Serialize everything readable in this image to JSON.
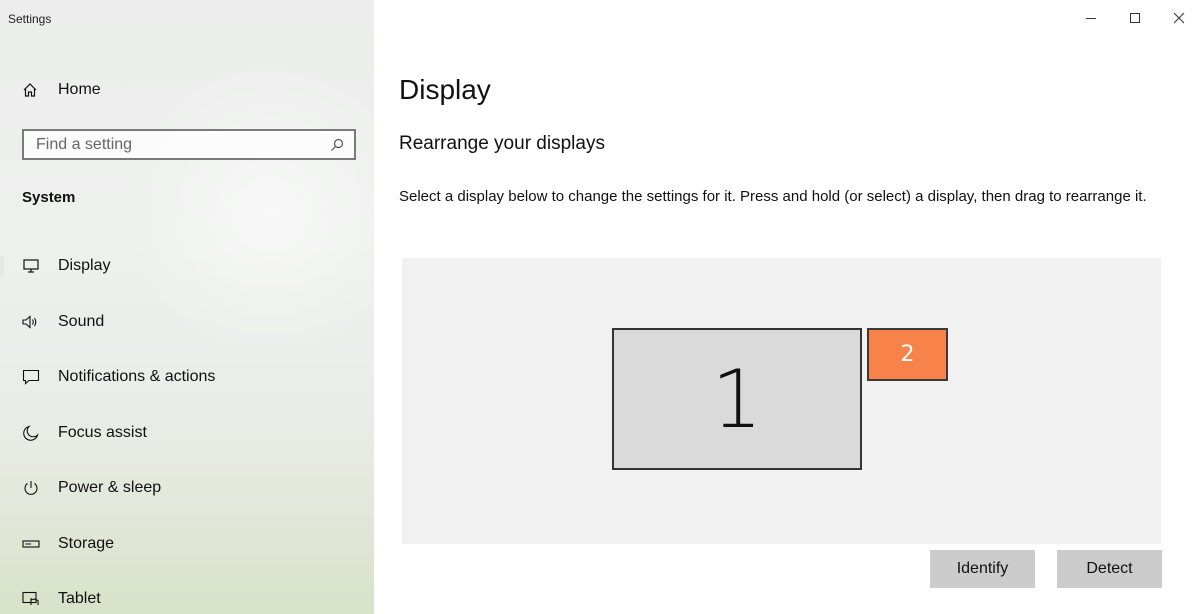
{
  "window": {
    "app_title": "Settings",
    "controls": [
      "minimize",
      "maximize",
      "close"
    ]
  },
  "sidebar": {
    "home_label": "Home",
    "search": {
      "placeholder": "Find a setting",
      "value": ""
    },
    "section_title": "System",
    "items": [
      {
        "label": "Display",
        "icon": "display-icon",
        "active": true
      },
      {
        "label": "Sound",
        "icon": "speaker-icon"
      },
      {
        "label": "Notifications & actions",
        "icon": "notifications-icon"
      },
      {
        "label": "Focus assist",
        "icon": "moon-icon"
      },
      {
        "label": "Power & sleep",
        "icon": "power-icon"
      },
      {
        "label": "Storage",
        "icon": "storage-icon"
      },
      {
        "label": "Tablet",
        "icon": "tablet-icon"
      }
    ]
  },
  "main": {
    "title": "Display",
    "subtitle": "Rearrange your displays",
    "description": "Select a display below to change the settings for it. Press and hold (or select) a display, then drag to rearrange it.",
    "displays": [
      {
        "number": "1",
        "selected": false
      },
      {
        "number": "2",
        "selected": true
      }
    ],
    "identify_label": "Identify",
    "detect_label": "Detect"
  },
  "colors": {
    "selected_display": "#f7834b",
    "display": "#dadada",
    "canvas": "#f1f1f1",
    "button": "#cccccc"
  }
}
